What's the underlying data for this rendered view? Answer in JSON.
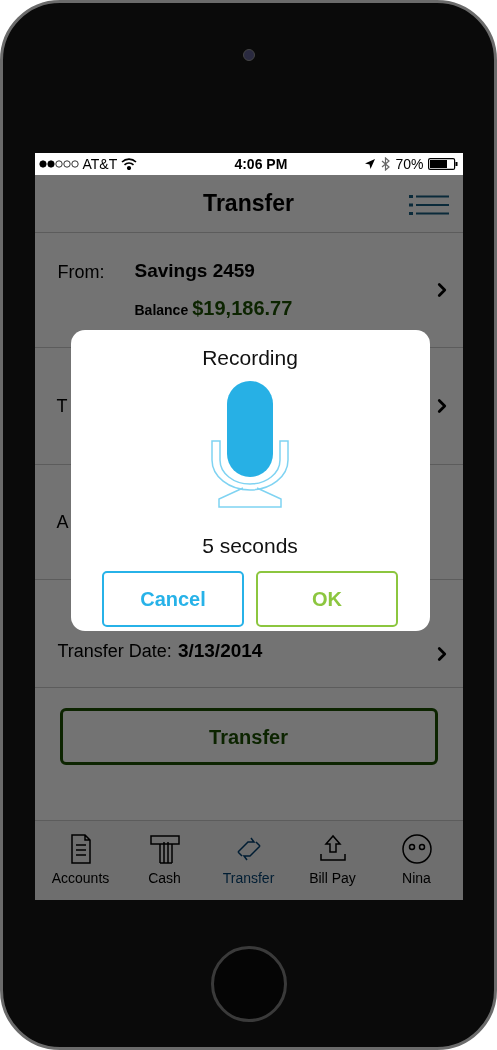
{
  "status_bar": {
    "carrier": "AT&T",
    "time": "4:06 PM",
    "battery": "70%"
  },
  "nav": {
    "title": "Transfer"
  },
  "rows": [
    {
      "kind": "account",
      "label": "From:",
      "value": "Savings 2459",
      "sub_label": "Balance",
      "sub_value": "$19,186.77",
      "chevron": true
    },
    {
      "kind": "partial",
      "label": "T",
      "chevron": true
    },
    {
      "kind": "partial",
      "label": "A",
      "chevron": false
    },
    {
      "kind": "date",
      "label": "Transfer Date:",
      "value": "3/13/2014",
      "chevron": true
    }
  ],
  "transfer_button": "Transfer",
  "dialog": {
    "title": "Recording",
    "status": "5 seconds",
    "buttons": [
      {
        "kind": "cancel",
        "label": "Cancel"
      },
      {
        "kind": "ok",
        "label": "OK"
      }
    ]
  },
  "tabs": [
    {
      "kind": "document",
      "label": "Accounts",
      "selected": false
    },
    {
      "kind": "cash",
      "label": "Cash",
      "selected": false
    },
    {
      "kind": "transfer",
      "label": "Transfer",
      "selected": true
    },
    {
      "kind": "billpay",
      "label": "Bill Pay",
      "selected": false
    },
    {
      "kind": "face",
      "label": "Nina",
      "selected": false
    }
  ]
}
